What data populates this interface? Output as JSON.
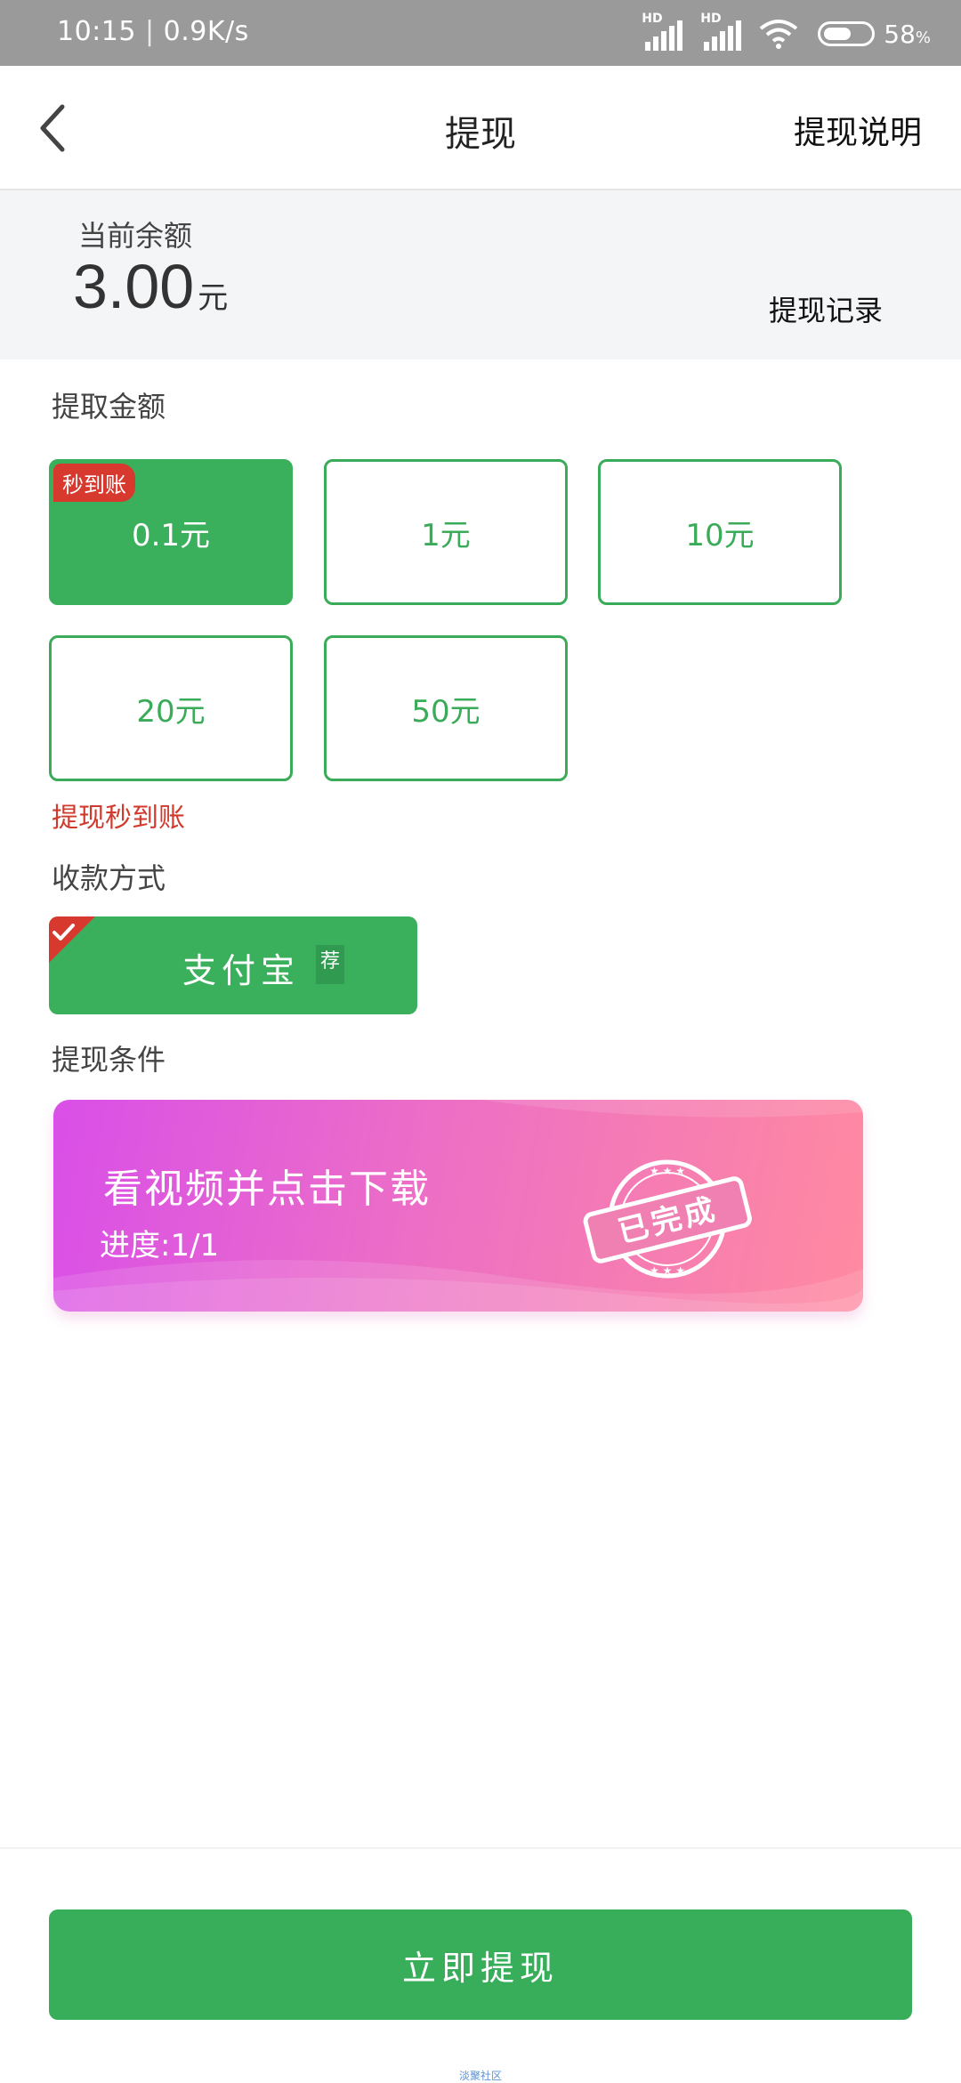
{
  "status_bar": {
    "time": "10:15",
    "net_speed": "0.9K/s",
    "signal_tag": "HD",
    "battery_level": "58",
    "battery_unit": "%"
  },
  "nav": {
    "title": "提现",
    "help": "提现说明"
  },
  "balance": {
    "label": "当前余额",
    "amount": "3.00",
    "unit": "元",
    "history": "提现记录"
  },
  "amount_section": {
    "title": "提取金额",
    "badge": "秒到账",
    "options": [
      "0.1元",
      "1元",
      "10元",
      "20元",
      "50元"
    ],
    "selected_index": 0,
    "note": "提现秒到账"
  },
  "payment": {
    "title": "收款方式",
    "method": "支付宝",
    "tag": "荐"
  },
  "condition": {
    "title": "提现条件",
    "task": "看视频并点击下载",
    "progress": "进度:1/1",
    "stamp": "已完成"
  },
  "submit": {
    "label": "立即提现"
  },
  "watermark": "淡聚社区",
  "colors": {
    "accent_green": "#3aaf5c",
    "badge_red": "#d7392e",
    "card_gradient_start": "#d94fe8",
    "card_gradient_end": "#ff8aa0"
  }
}
